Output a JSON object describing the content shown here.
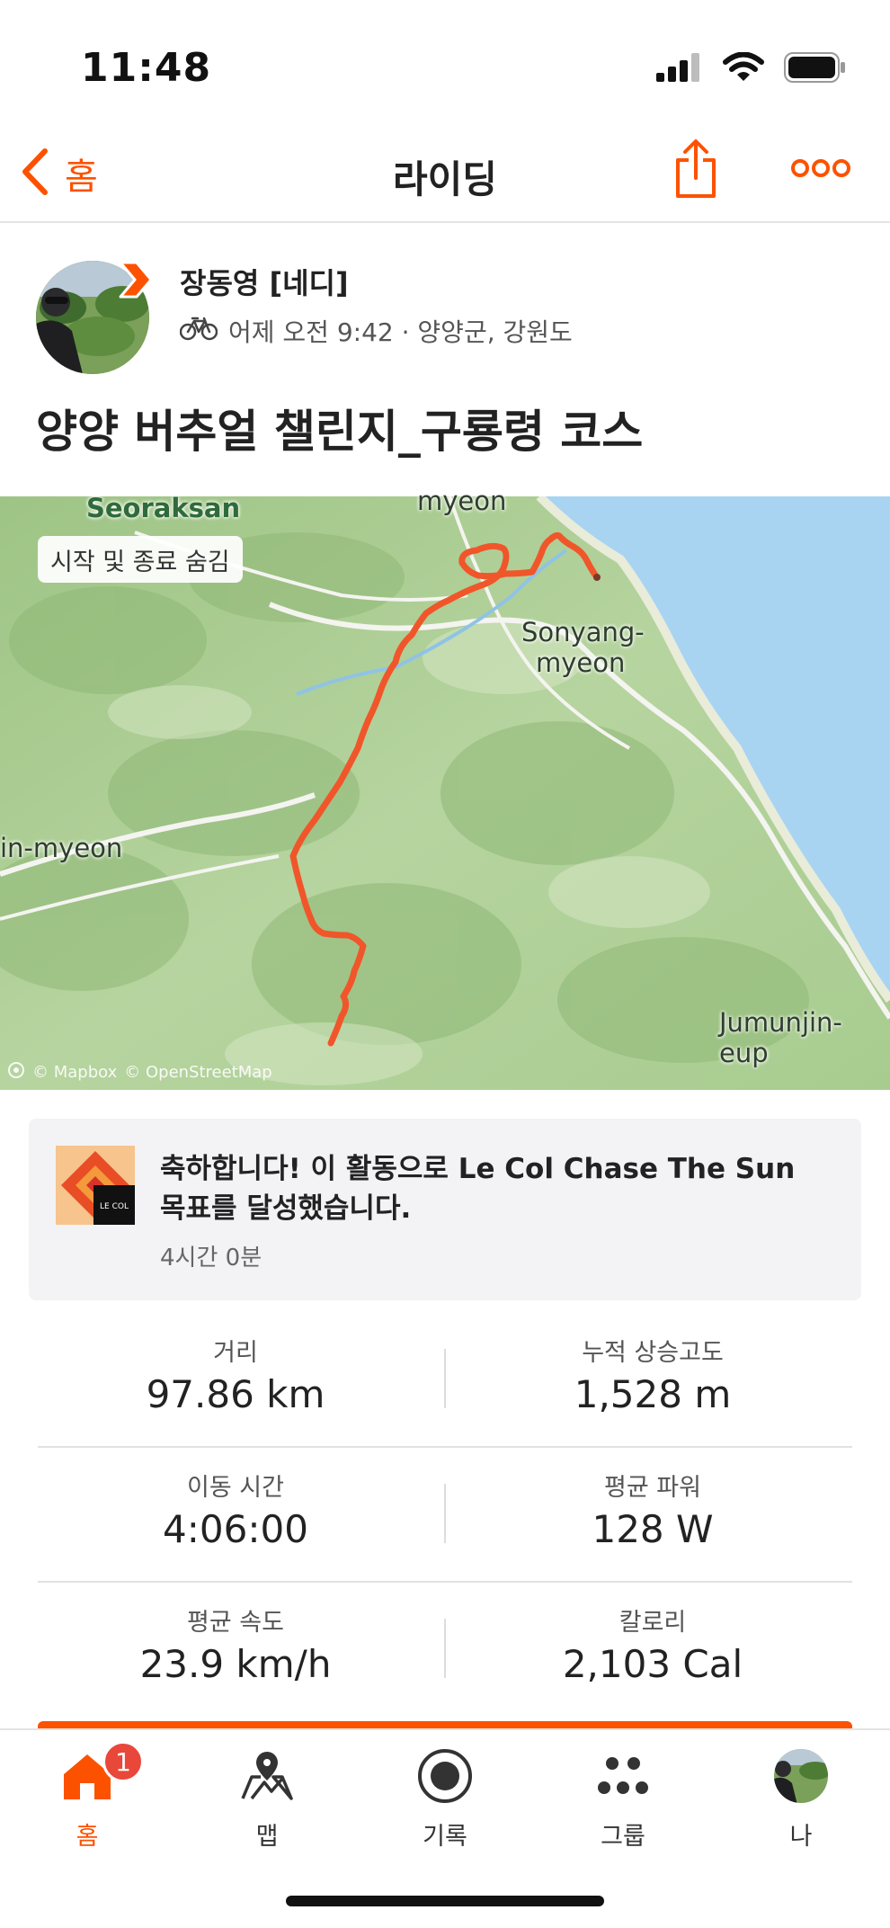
{
  "status": {
    "time": "11:48"
  },
  "nav": {
    "back_label": "홈",
    "title": "라이딩"
  },
  "athlete": {
    "name": "장동영 [네디]"
  },
  "activity": {
    "meta": "어제 오전 9:42 · 양양군, 강원도",
    "title": "양양 버추얼 챌린지_구룡령 코스"
  },
  "map": {
    "chip": "시작 및 종료 숨김",
    "labels": {
      "seoraksan": "Seoraksan",
      "myeon_top": "myeon",
      "sonyang": "Sonyang-",
      "sonyang2": "myeon",
      "in_myeon": "in-myeon",
      "jumunjin": "Jumunjin-eup"
    },
    "attribution": {
      "mapbox": "© Mapbox",
      "osm": "© OpenStreetMap"
    },
    "route_color": "#f0562a"
  },
  "achievement": {
    "text_line1": "축하합니다! 이 활동으로 Le Col Chase The Sun",
    "text_line2": "목표를 달성했습니다.",
    "badge_text": "LE COL",
    "time": "4시간 0분"
  },
  "stats": [
    {
      "left": {
        "label": "거리",
        "value": "97.86 km"
      },
      "right": {
        "label": "누적 상승고도",
        "value": "1,528 m"
      }
    },
    {
      "left": {
        "label": "이동 시간",
        "value": "4:06:00"
      },
      "right": {
        "label": "평균 파워",
        "value": "128 W"
      }
    },
    {
      "left": {
        "label": "평균 속도",
        "value": "23.9 km/h"
      },
      "right": {
        "label": "칼로리",
        "value": "2,103 Cal"
      }
    }
  ],
  "tabs": [
    {
      "label": "홈",
      "badge": "1"
    },
    {
      "label": "맵"
    },
    {
      "label": "기록"
    },
    {
      "label": "그룹"
    },
    {
      "label": "나"
    }
  ],
  "colors": {
    "accent": "#fc5200",
    "badge": "#e8473a"
  }
}
